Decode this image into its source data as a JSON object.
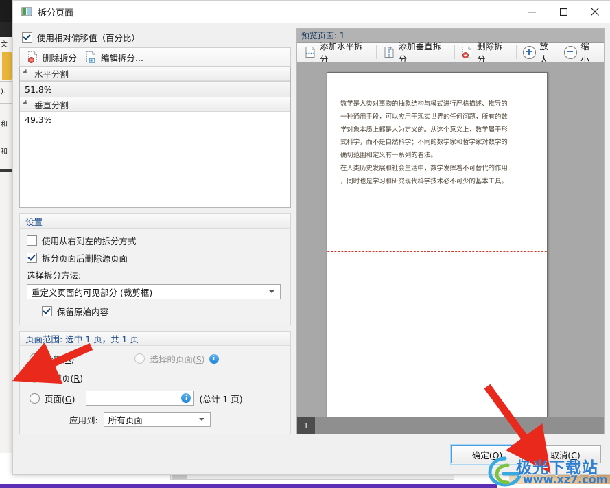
{
  "window": {
    "title": "拆分页面",
    "icon": "split-page-icon",
    "controls": {
      "minimize": "—",
      "maximize": "☐",
      "close": "✕"
    }
  },
  "left_panel": {
    "use_relative_offset": {
      "label": "使用相对偏移值（百分比）",
      "checked": true
    },
    "toolbar": [
      {
        "name": "delete-split",
        "label": "删除拆分",
        "icon": "page-delete-icon"
      },
      {
        "name": "edit-split",
        "label": "编辑拆分...",
        "icon": "page-edit-icon"
      }
    ],
    "splits": [
      {
        "group": "水平分割",
        "value": "51.8%",
        "selected": true
      },
      {
        "group": "垂直分割",
        "value": "49.3%",
        "selected": false
      }
    ],
    "settings": {
      "caption": "设置",
      "rtl_split": {
        "label": "使用从右到左的拆分方式",
        "checked": false
      },
      "delete_source": {
        "label": "拆分页面后删除源页面",
        "checked": true
      },
      "method_label": "选择拆分方法:",
      "method_value": "重定义页面的可见部分 (裁剪框)",
      "keep_original": {
        "label": "保留原始内容",
        "checked": true
      }
    },
    "page_range": {
      "caption": "页面范围: 选中 1 页，共 1 页",
      "options": [
        {
          "name": "all",
          "label": "全部(A)",
          "accesskey": "A",
          "checked": true,
          "disabled": false
        },
        {
          "name": "selected-pages",
          "label": "选择的页面(S)",
          "accesskey": "S",
          "checked": false,
          "disabled": true,
          "info": true
        },
        {
          "name": "current-page",
          "label": "当前页(R)",
          "accesskey": "R",
          "checked": false,
          "disabled": false
        },
        {
          "name": "pages",
          "label": "页面(G)",
          "accesskey": "G",
          "checked": false,
          "disabled": false,
          "info": true
        }
      ],
      "pages_input_value": "",
      "pages_total_text": "(总计 1 页)",
      "apply_to_label": "应用到:",
      "apply_to_value": "所有页面"
    }
  },
  "preview": {
    "caption": "预览页面: 1",
    "toolbar": [
      {
        "name": "add-horizontal-split",
        "label": "添加水平拆分",
        "icon": "page-hsplit-icon"
      },
      {
        "name": "add-vertical-split",
        "label": "添加垂直拆分",
        "icon": "page-vsplit-icon"
      },
      {
        "name": "delete-split",
        "label": "删除拆分",
        "icon": "page-delete-icon"
      },
      {
        "name": "zoom-in",
        "label": "放大",
        "icon": "zoom-in-icon"
      },
      {
        "name": "zoom-out",
        "label": "缩小",
        "icon": "zoom-out-icon"
      }
    ],
    "page_text": "数学是人类对事物的抽象结构与模式进行严格描述、推导的\n一种通用手段，可以应用于现实世界的任何问题，所有的数\n学对象本质上都是人为定义的。从这个意义上，数学属于形\n式科学，而不是自然科学；不同的数学家和哲学家对数学的\n确切范围和定义有一系列的看法。\n在人类历史发展和社会生活中，数学发挥着不可替代的作用\n，同时也是学习和研究现代科学技术必不可少的基本工具。",
    "thumbnail_number": "1",
    "vertical_split_pos_pct": 49.3,
    "horizontal_split_pos_pct": 51.8
  },
  "footer": {
    "ok_label": "确定(O)",
    "ok_accesskey": "O",
    "cancel_label": "取消(C)",
    "cancel_accesskey": "C"
  },
  "watermark": {
    "text": "极光下载站",
    "url": "www.xz7.com"
  },
  "colors": {
    "accent": "#2f7fd0",
    "dialog_bg": "#f0f0f0",
    "caption_text": "#1f4e8c",
    "split_red": "#d33a2f",
    "arrow_red": "#e8291c"
  }
}
